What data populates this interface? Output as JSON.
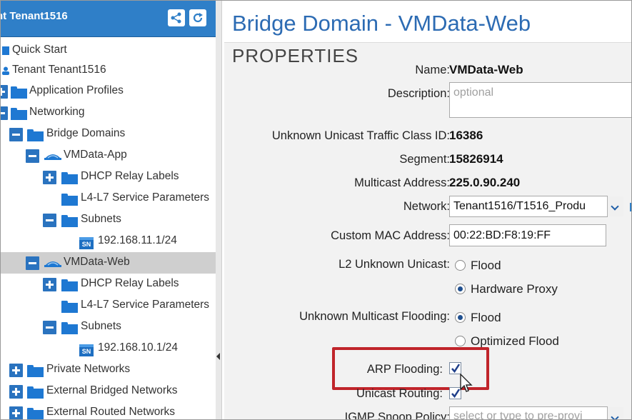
{
  "tree": {
    "header_title": "nt Tenant1516",
    "items": [
      {
        "label": "Quick Start"
      },
      {
        "label": "Tenant Tenant1516"
      },
      {
        "label": "Application Profiles"
      },
      {
        "label": "Networking"
      },
      {
        "label": "Bridge Domains"
      },
      {
        "label": "VMData-App"
      },
      {
        "label": "DHCP Relay Labels"
      },
      {
        "label": "L4-L7 Service Parameters"
      },
      {
        "label": "Subnets"
      },
      {
        "label": "192.168.11.1/24"
      },
      {
        "label": "VMData-Web"
      },
      {
        "label": "DHCP Relay Labels"
      },
      {
        "label": "L4-L7 Service Parameters"
      },
      {
        "label": "Subnets"
      },
      {
        "label": "192.168.10.1/24"
      },
      {
        "label": "Private Networks"
      },
      {
        "label": "External Bridged Networks"
      },
      {
        "label": "External Routed Networks"
      }
    ],
    "subnet_badge": "SN"
  },
  "page": {
    "title": "Bridge Domain - VMData-Web",
    "section": "PROPERTIES"
  },
  "properties": {
    "name_label": "Name:",
    "name_value": "VMData-Web",
    "description_label": "Description:",
    "description_placeholder": "optional",
    "class_id_label": "Unknown Unicast Traffic Class ID:",
    "class_id_value": "16386",
    "segment_label": "Segment:",
    "segment_value": "15826914",
    "multicast_label": "Multicast Address:",
    "multicast_value": "225.0.90.240",
    "network_label": "Network:",
    "network_value": "Tenant1516/T1516_Produ",
    "mac_label": "Custom MAC Address:",
    "mac_value": "00:22:BD:F8:19:FF",
    "l2_label": "L2 Unknown Unicast:",
    "l2_opt1": "Flood",
    "l2_opt2": "Hardware Proxy",
    "l2_selected": "Hardware Proxy",
    "mcast_flood_label": "Unknown Multicast Flooding:",
    "mcast_opt1": "Flood",
    "mcast_opt2": "Optimized Flood",
    "mcast_selected": "Flood",
    "arp_label": "ARP Flooding:",
    "arp_checked": true,
    "unicast_routing_label": "Unicast Routing:",
    "unicast_routing_checked": true,
    "igmp_label": "IGMP Snoop Policy:",
    "igmp_placeholder": "select or type to pre-provi"
  },
  "colors": {
    "accent": "#2f7fc8",
    "title": "#2c6bb3",
    "highlight": "#c0242a",
    "selected_row": "#cfcfcf"
  },
  "icons": [
    "share-icon",
    "refresh-icon",
    "folder-icon",
    "expand-icon",
    "collapse-icon",
    "bridge-domain-icon",
    "subnet-icon",
    "dropdown-icon",
    "cursor-icon"
  ]
}
